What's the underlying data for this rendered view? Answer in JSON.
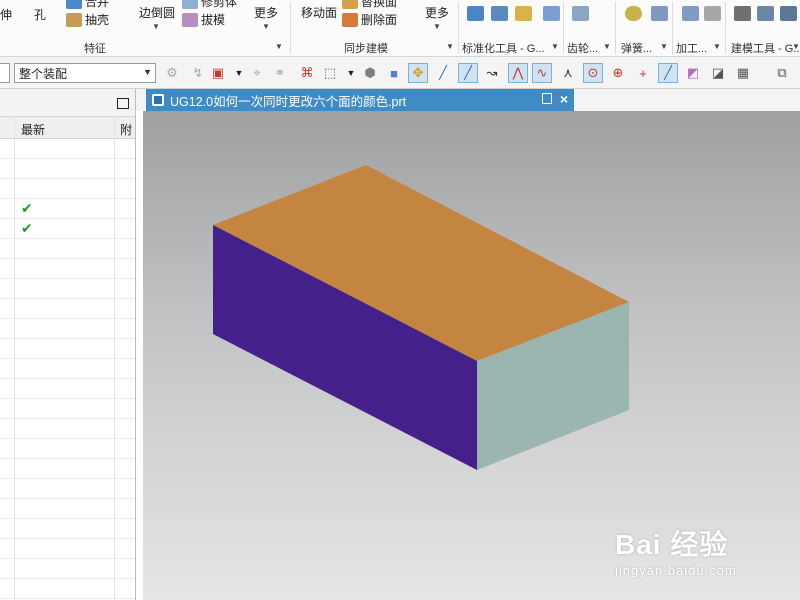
{
  "ribbon": {
    "items": {
      "stretch": "伸",
      "hole": "孔",
      "merge": "合并",
      "shell": "抽壳",
      "edge_blend": "边倒圆",
      "trim_body": "修剪体",
      "draft": "拔模",
      "more_1": "更多",
      "move_face": "移动面",
      "replace_face": "替换面",
      "delete_face": "删除面",
      "more_2": "更多"
    },
    "groups": {
      "features": "特征",
      "sync_modeling": "同步建模",
      "std_tools": "标准化工具 - G...",
      "gear": "齿轮...",
      "spring": "弹簧...",
      "machining": "加工...",
      "modeling_tools": "建模工具 - G..."
    }
  },
  "toolbar": {
    "filter_value": "",
    "assembly_scope": "整个装配"
  },
  "navigator": {
    "columns": {
      "latest": "最新",
      "attached": "附"
    },
    "rows": [
      {
        "latest_check": ""
      },
      {
        "latest_check": ""
      },
      {
        "latest_check": ""
      },
      {
        "latest_check": "✔"
      },
      {
        "latest_check": "✔"
      },
      {
        "latest_check": ""
      },
      {
        "latest_check": ""
      },
      {
        "latest_check": ""
      },
      {
        "latest_check": ""
      },
      {
        "latest_check": ""
      },
      {
        "latest_check": ""
      },
      {
        "latest_check": ""
      },
      {
        "latest_check": ""
      },
      {
        "latest_check": ""
      },
      {
        "latest_check": ""
      },
      {
        "latest_check": ""
      },
      {
        "latest_check": ""
      },
      {
        "latest_check": ""
      },
      {
        "latest_check": ""
      },
      {
        "latest_check": ""
      },
      {
        "latest_check": ""
      },
      {
        "latest_check": ""
      },
      {
        "latest_check": ""
      }
    ]
  },
  "tab": {
    "title": "UG12.0如何一次同时更改六个面的颜色.prt"
  },
  "viewport": {
    "faces": {
      "top": "#c48540",
      "front": "#44218a",
      "side": "#9bb5b1"
    }
  },
  "watermark": {
    "brand": "Bai 经验",
    "url": "jingyan.baidu.com"
  },
  "colors": {
    "tab_active": "#3f8bc6",
    "check_green": "#1f9b25",
    "toolbar_active": "#cfe3f2"
  }
}
